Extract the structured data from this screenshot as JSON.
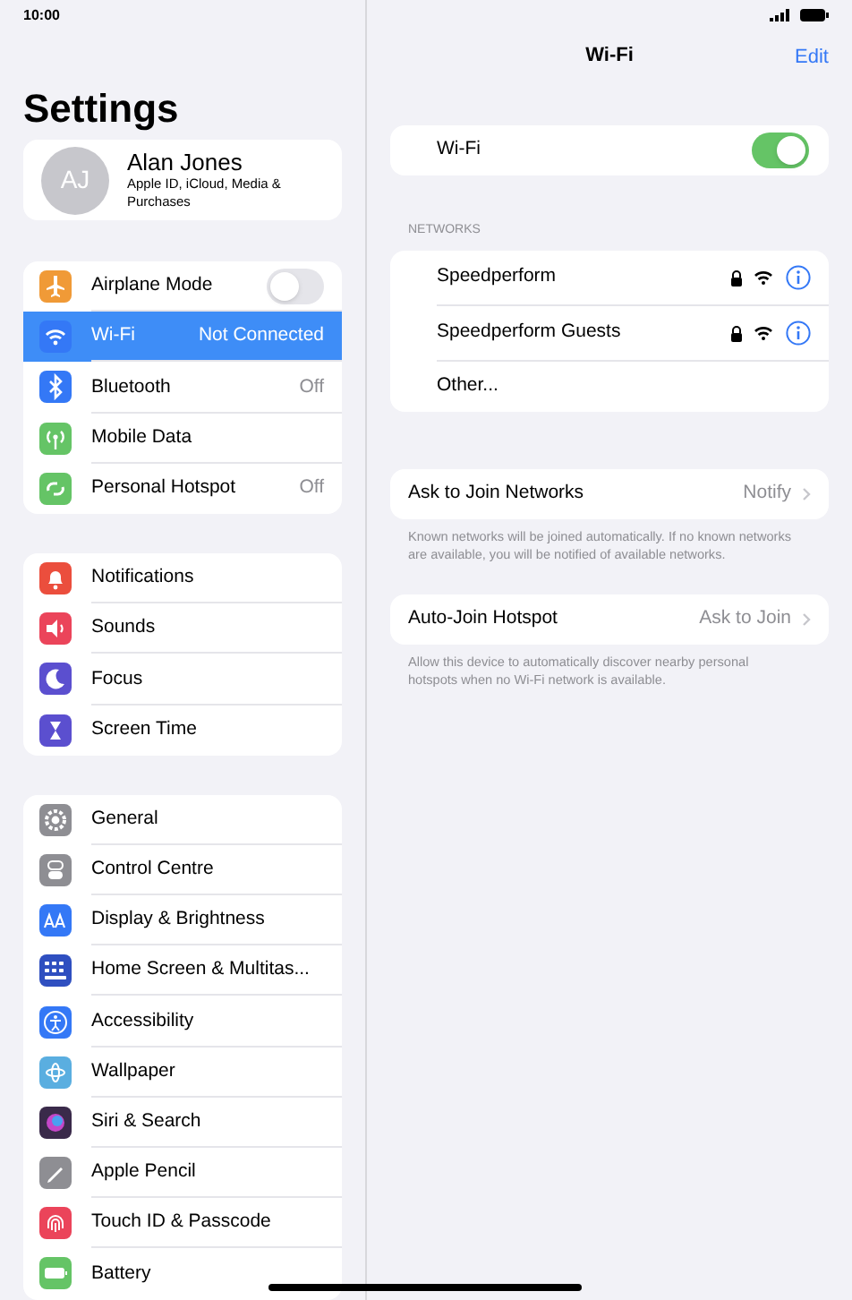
{
  "status_bar": {
    "time": "10:00"
  },
  "sidebar": {
    "title": "Settings",
    "profile": {
      "initials": "AJ",
      "name": "Alan Jones",
      "subtitle": "Apple ID, iCloud, Media & Purchases"
    },
    "groups": [
      [
        {
          "label": "Airplane Mode",
          "kind": "toggle",
          "on": false,
          "color": "#f09a37",
          "selected": false
        },
        {
          "label": "Wi-Fi",
          "kind": "value",
          "value": "Not Connected",
          "color": "#3478f6",
          "selected": true
        },
        {
          "label": "Bluetooth",
          "kind": "value",
          "value": "Off",
          "color": "#3478f6",
          "selected": false
        },
        {
          "label": "Mobile Data",
          "kind": "plain",
          "color": "#65c466",
          "selected": false
        },
        {
          "label": "Personal Hotspot",
          "kind": "value",
          "value": "Off",
          "color": "#65c466",
          "selected": false
        }
      ],
      [
        {
          "label": "Notifications",
          "kind": "plain",
          "color": "#eb4e3d",
          "selected": false
        },
        {
          "label": "Sounds",
          "kind": "plain",
          "color": "#eb445a",
          "selected": false
        },
        {
          "label": "Focus",
          "kind": "plain",
          "color": "#5b4fcf",
          "selected": false
        },
        {
          "label": "Screen Time",
          "kind": "plain",
          "color": "#5b4fcf",
          "selected": false
        }
      ],
      [
        {
          "label": "General",
          "kind": "plain",
          "color": "#8e8e93",
          "selected": false
        },
        {
          "label": "Control Centre",
          "kind": "plain",
          "color": "#8e8e93",
          "selected": false
        },
        {
          "label": "Display & Brightness",
          "kind": "plain",
          "color": "#3478f6",
          "selected": false
        },
        {
          "label": "Home Screen & Multitas...",
          "kind": "plain",
          "color": "#2f4fc0",
          "selected": false
        },
        {
          "label": "Accessibility",
          "kind": "plain",
          "color": "#3478f6",
          "selected": false
        },
        {
          "label": "Wallpaper",
          "kind": "plain",
          "color": "#5aaee0",
          "selected": false
        },
        {
          "label": "Siri & Search",
          "kind": "plain",
          "color": "#3a2a4a",
          "selected": false
        },
        {
          "label": "Apple Pencil",
          "kind": "plain",
          "color": "#8e8e93",
          "selected": false
        },
        {
          "label": "Touch ID & Passcode",
          "kind": "plain",
          "color": "#eb445a",
          "selected": false
        },
        {
          "label": "Battery",
          "kind": "plain",
          "color": "#65c466",
          "selected": false
        }
      ]
    ]
  },
  "detail": {
    "title": "Wi-Fi",
    "edit": "Edit",
    "wifi": {
      "label": "Wi-Fi",
      "on": true
    },
    "networks_header": "NETWORKS",
    "networks": [
      {
        "name": "Speedperform",
        "locked": true
      },
      {
        "name": "Speedperform Guests",
        "locked": true
      }
    ],
    "other": "Other...",
    "settings": [
      {
        "label": "Ask to Join Networks",
        "value": "Notify",
        "note": "Known networks will be joined automatically. If no known networks are available, you will be notified of available networks."
      },
      {
        "label": "Auto-Join Hotspot",
        "value": "Ask to Join",
        "note": "Allow this device to automatically discover nearby personal hotspots when no Wi-Fi network is available."
      }
    ]
  }
}
